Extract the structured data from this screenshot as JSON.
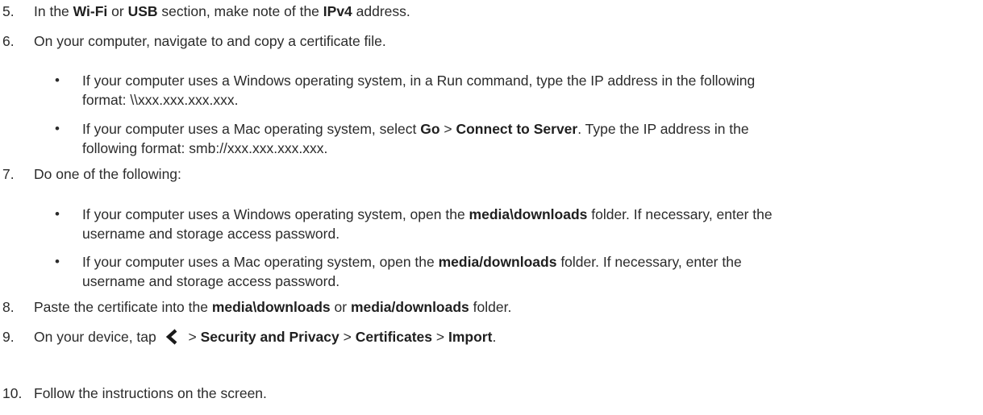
{
  "steps": {
    "s5": {
      "number": "5.",
      "t1": "In the ",
      "b1": "Wi-Fi",
      "t2": " or ",
      "b2": "USB",
      "t3": " section, make note of the ",
      "b3": "IPv4",
      "t4": " address."
    },
    "s6": {
      "number": "6.",
      "text": "On your computer, navigate to and copy a certificate file.",
      "bullets": [
        {
          "line1": "If your computer uses a Windows operating system, in a Run command, type the IP address in the following",
          "line2": "format: \\\\xxx.xxx.xxx.xxx."
        },
        {
          "t1": "If your computer uses a Mac operating system, select ",
          "b1": "Go",
          "t2": " > ",
          "b2": "Connect to Server",
          "t3": ". Type the IP address in the",
          "line2": "following format: smb://xxx.xxx.xxx.xxx."
        }
      ]
    },
    "s7": {
      "number": "7.",
      "text": "Do one of the following:",
      "bullets": [
        {
          "t1": "If your computer uses a Windows operating system, open the ",
          "b1": "media\\downloads",
          "t2": " folder. If necessary, enter the",
          "line2": "username and storage access password."
        },
        {
          "t1": "If your computer uses a Mac operating system, open the ",
          "b1": "media/downloads",
          "t2": " folder. If necessary, enter the",
          "line2": "username and storage access password."
        }
      ]
    },
    "s8": {
      "number": "8.",
      "t1": "Paste the certificate into the ",
      "b1": "media\\downloads",
      "t2": " or ",
      "b2": "media/downloads",
      "t3": " folder."
    },
    "s9": {
      "number": "9.",
      "t1": "On your device, tap ",
      "icon": "back-chevron-icon",
      "t2": " > ",
      "b1": "Security and Privacy",
      "t3": " > ",
      "b2": "Certificates",
      "t4": " > ",
      "b3": "Import",
      "t5": "."
    },
    "s10": {
      "number": "10.",
      "text": "Follow the instructions on the screen."
    }
  },
  "bullet_glyph": "•"
}
